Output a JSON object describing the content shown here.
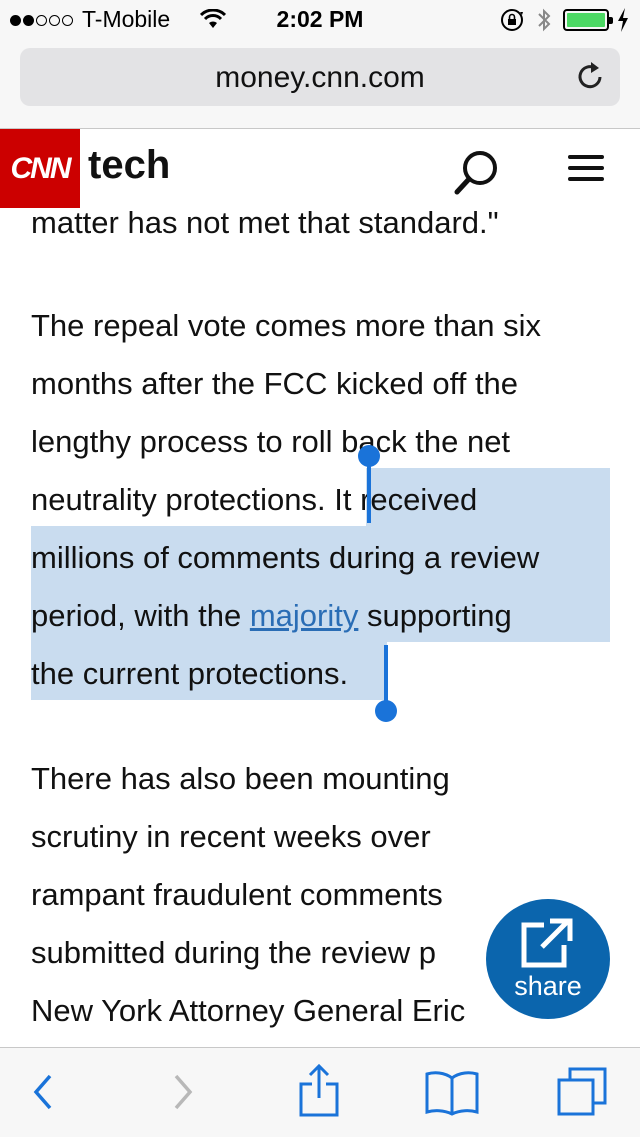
{
  "status_bar": {
    "carrier": "T-Mobile",
    "time": "2:02 PM",
    "signal_bars_filled": 2,
    "signal_bars_total": 5
  },
  "browser": {
    "url": "money.cnn.com"
  },
  "site_header": {
    "logo_text": "CNN",
    "section": "tech"
  },
  "article": {
    "lines": [
      "matter has not met that standard.\"",
      "The repeal vote comes more than six",
      "months after the FCC kicked off the",
      "lengthy process to roll back the net",
      "neutrality protections. It received",
      "millions of comments during a review",
      "period, with the ",
      "majority",
      " supporting",
      "the current protections.",
      "There has also been mounting",
      "scrutiny in recent weeks over",
      "rampant fraudulent comments",
      "submitted during the review p",
      "New York Attorney General Eric"
    ],
    "selected_prefix": "neutrality protections. ",
    "selected_suffix": "It received"
  },
  "share_button": {
    "label": "share"
  },
  "colors": {
    "cnn_red": "#cc0000",
    "selection": "#c9dcef",
    "handle": "#1a73d9",
    "share_bg": "#0b65ad",
    "ios_blue": "#1a73d9"
  },
  "icons": [
    "wifi-icon",
    "lock-rotation-icon",
    "bluetooth-icon",
    "battery-icon",
    "reload-icon",
    "search-icon",
    "menu-icon",
    "share-icon",
    "back-icon",
    "forward-icon",
    "share-sheet-icon",
    "bookmarks-icon",
    "tabs-icon"
  ]
}
